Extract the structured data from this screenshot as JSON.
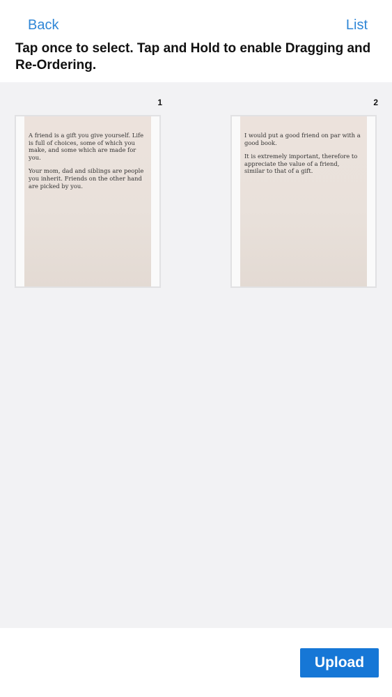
{
  "nav": {
    "back_label": "Back",
    "list_label": "List"
  },
  "instruction": "Tap once to select. Tap and Hold to enable Dragging and Re-Ordering.",
  "pages": [
    {
      "number": "1",
      "paragraphs": [
        "A friend is a gift you give yourself. Life is full of choices, some of which you make, and some which are made for you.",
        "Your mom, dad and siblings are people you inherit. Friends on the other hand are picked by you."
      ]
    },
    {
      "number": "2",
      "paragraphs": [
        "I would put a good friend on par with a good book.",
        "It is extremely important, therefore to appreciate the value of a friend, similar to that of a gift."
      ]
    }
  ],
  "footer": {
    "upload_label": "Upload"
  },
  "colors": {
    "accent": "#2f86d6",
    "button": "#1677d6",
    "grid_background": "#f2f2f4"
  }
}
